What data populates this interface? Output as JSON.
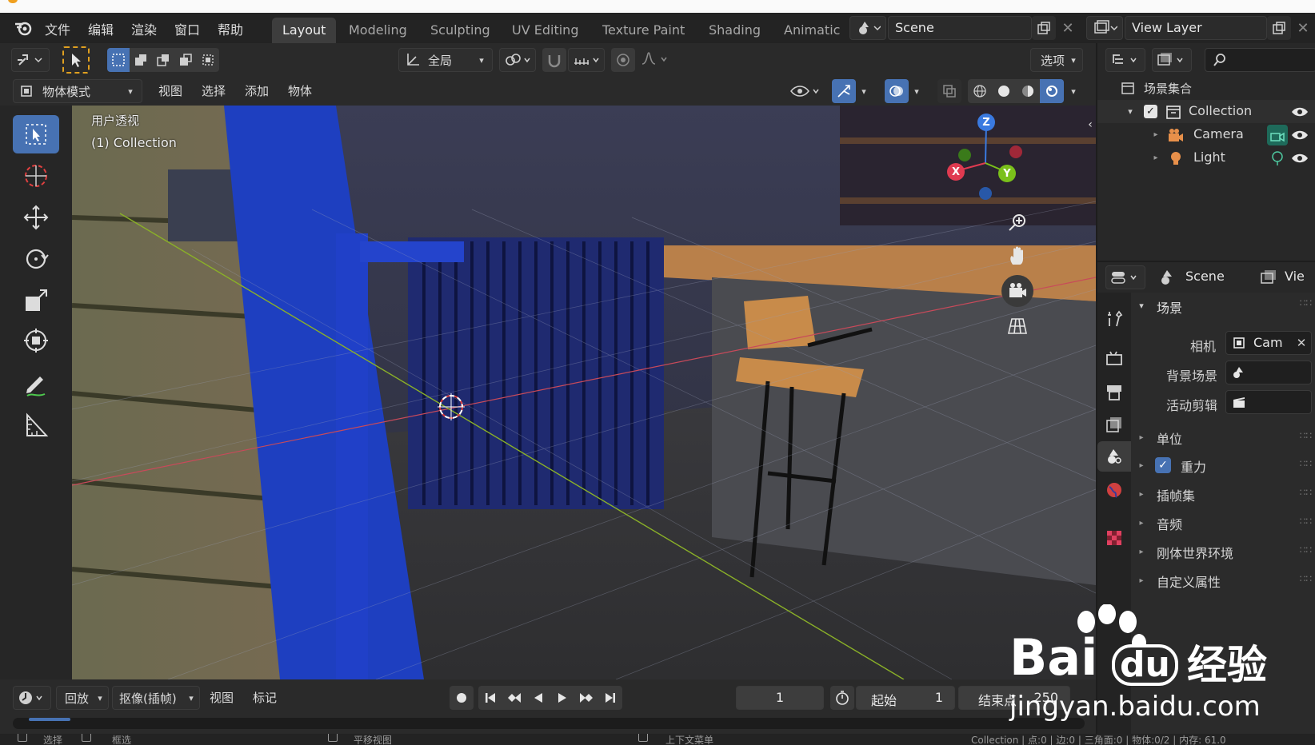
{
  "menu": {
    "items": [
      "文件",
      "编辑",
      "渲染",
      "窗口",
      "帮助"
    ],
    "workspaces": [
      "Layout",
      "Modeling",
      "Sculpting",
      "UV Editing",
      "Texture Paint",
      "Shading",
      "Animatic"
    ],
    "scene": "Scene",
    "view_layer": "View Layer"
  },
  "toolrow": {
    "transform_orientation": "全局",
    "options": "选项"
  },
  "header": {
    "mode": "物体模式",
    "menus": [
      "视图",
      "选择",
      "添加",
      "物体"
    ]
  },
  "viewport": {
    "view_name": "用户透视",
    "collection_label": "(1) Collection",
    "axis_labels": {
      "z": "Z",
      "x": "X",
      "y": "Y"
    }
  },
  "outliner": {
    "root": "场景集合",
    "collection": "Collection",
    "items": [
      "Camera",
      "Light"
    ]
  },
  "properties": {
    "scene_tab": "Scene",
    "view_tab": "Vie",
    "panel_title": "场景",
    "camera_label": "相机",
    "camera_value": "Cam",
    "background_label": "背景场景",
    "clip_label": "活动剪辑",
    "sections": [
      "单位",
      "重力",
      "插帧集",
      "音频",
      "刚体世界环境",
      "自定义属性"
    ]
  },
  "timeline": {
    "menus": [
      "回放",
      "抠像(插帧)",
      "视图",
      "标记"
    ],
    "current_frame": "1",
    "start_label": "起始",
    "start_value": "1",
    "end_label": "结束点",
    "end_value": "250"
  },
  "statusbar": {
    "left1": "选择",
    "left2": "框选",
    "mid1": "平移视图",
    "mid2": "上下文菜单",
    "right": "Collection | 点:0 | 边:0 | 三角面:0 | 物体:0/2 | 内存: 61.0"
  },
  "watermark": {
    "brand": "Bai",
    "brand2": "du",
    "cn": "经验",
    "url": "jingyan.baidu.com"
  }
}
